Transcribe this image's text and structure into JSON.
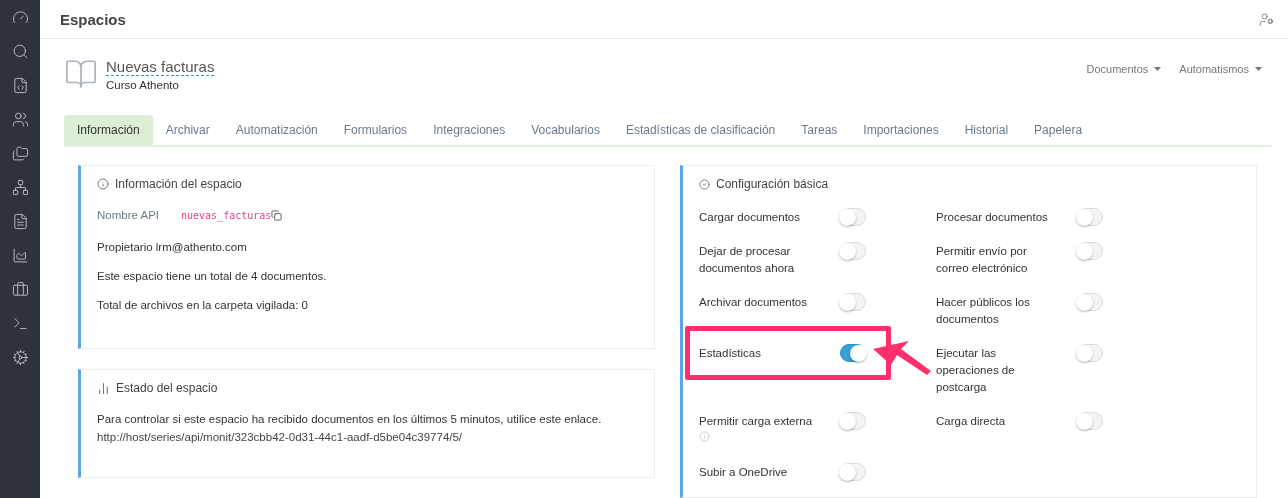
{
  "header": {
    "title": "Espacios"
  },
  "space": {
    "name": "Nuevas facturas",
    "subtitle": "Curso Athento",
    "menus": [
      "Documentos",
      "Automatismos"
    ]
  },
  "tabs": [
    {
      "label": "Información",
      "selected": true
    },
    {
      "label": "Archivar",
      "selected": false
    },
    {
      "label": "Automatización",
      "selected": false
    },
    {
      "label": "Formularios",
      "selected": false
    },
    {
      "label": "Integraciones",
      "selected": false
    },
    {
      "label": "Vocabularios",
      "selected": false
    },
    {
      "label": "Estadísticas de clasificación",
      "selected": false
    },
    {
      "label": "Tareas",
      "selected": false
    },
    {
      "label": "Importaciones",
      "selected": false
    },
    {
      "label": "Historial",
      "selected": false
    },
    {
      "label": "Papelera",
      "selected": false
    }
  ],
  "info_card": {
    "title": "Información del espacio",
    "api_label": "Nombre API",
    "api_value": "nuevas_facturas",
    "lines": [
      "Propietario lrm@athento.com",
      "Este espacio tiene un total de 4 documentos.",
      "Total de archivos en la carpeta vigilada: 0"
    ]
  },
  "status_card": {
    "title": "Estado del espacio",
    "text": "Para controlar si este espacio ha recibido documentos en los últimos 5 minutos, utilice este enlace.",
    "link": "http://host/series/api/monit/323cbb42-0d31-44c1-aadf-d5be04c39774/5/"
  },
  "config_card": {
    "title": "Configuración básica",
    "items": [
      {
        "label": "Cargar documentos",
        "on": false
      },
      {
        "label": "Procesar documentos",
        "on": false
      },
      {
        "label": "Dejar de procesar documentos ahora",
        "on": false
      },
      {
        "label": "Permitir envío por correo electrónico",
        "on": false
      },
      {
        "label": "Archivar documentos",
        "on": false
      },
      {
        "label": "Hacer públicos los documentos",
        "on": false
      },
      {
        "label": "Estadísticas",
        "on": true,
        "highlighted": true
      },
      {
        "label": "Ejecutar las operaciones de postcarga",
        "on": false
      },
      {
        "label": "Permitir carga externa",
        "on": false,
        "info": true
      },
      {
        "label": "Carga directa",
        "on": false
      },
      {
        "label": "Subir a OneDrive",
        "on": false
      }
    ]
  }
}
